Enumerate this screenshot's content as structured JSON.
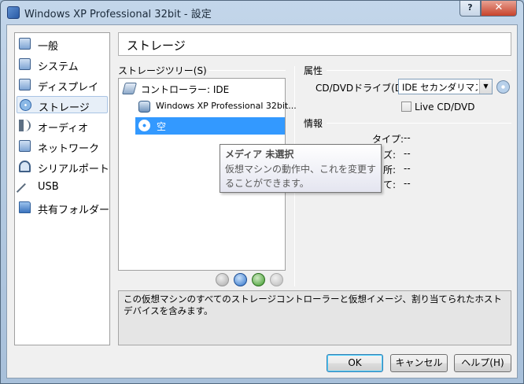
{
  "window": {
    "title": "Windows XP Professional 32bit - 設定",
    "help_btn": "?",
    "close_btn": "✕"
  },
  "sidebar": {
    "items": [
      {
        "label": "一般",
        "icon": "general-icon"
      },
      {
        "label": "システム",
        "icon": "system-icon"
      },
      {
        "label": "ディスプレイ",
        "icon": "display-icon"
      },
      {
        "label": "ストレージ",
        "icon": "storage-icon",
        "selected": true
      },
      {
        "label": "オーディオ",
        "icon": "audio-icon"
      },
      {
        "label": "ネットワーク",
        "icon": "network-icon"
      },
      {
        "label": "シリアルポート",
        "icon": "serial-port-icon"
      },
      {
        "label": "USB",
        "icon": "usb-icon"
      },
      {
        "label": "共有フォルダー",
        "icon": "shared-folder-icon"
      }
    ]
  },
  "main": {
    "section_title": "ストレージ",
    "tree_group_title": "ストレージツリー(S)",
    "tree": [
      {
        "label": "コントローラー: IDE",
        "icon": "controller-icon"
      },
      {
        "label": "Windows XP Professional 32bit...",
        "icon": "hard-disk-icon"
      },
      {
        "label": "空",
        "icon": "cd-icon",
        "selected": true
      }
    ],
    "attributes_title": "属性",
    "cd_drive_label": "CD/DVDドライブ(D):",
    "cd_drive_value": "IDE セカンダリマスタ",
    "live_cd_label": "Live CD/DVD",
    "info_title": "情報",
    "info_rows": [
      {
        "key": "タイプ:",
        "value": "--"
      },
      {
        "key": "ズ:",
        "value": "--"
      },
      {
        "key": "所:",
        "value": "--"
      },
      {
        "key": "て:",
        "value": "--"
      }
    ],
    "description": "この仮想マシンのすべてのストレージコントローラーと仮想イメージ、割り当てられたホストデバイスを含みます。"
  },
  "tooltip": {
    "title": "メディア 未選択",
    "body": "仮想マシンの動作中、これを変更することができます。"
  },
  "buttons": {
    "ok": "OK",
    "cancel": "キャンセル",
    "help": "ヘルプ(H)"
  },
  "colors": {
    "selection": "#3399ff",
    "title_bar": "#b5cbe2",
    "close_button": "#c7432b"
  }
}
